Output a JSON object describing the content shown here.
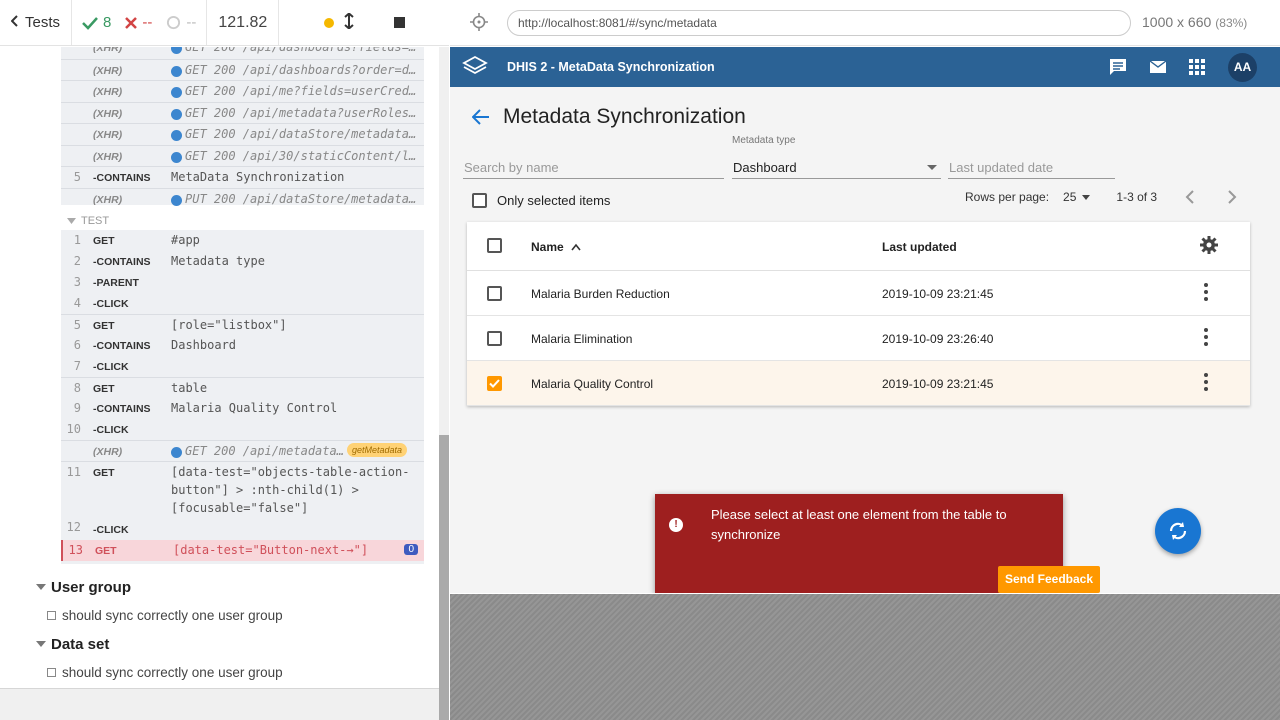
{
  "runner": {
    "tests_label": "Tests",
    "passed": "8",
    "failed": "--",
    "pending": "--",
    "duration": "121.82"
  },
  "reporter": {
    "log_top": [
      {
        "num": "",
        "method": "(XHR)",
        "arg": "GET 200 /api/dashboards?fields=…",
        "type": "xhr"
      },
      {
        "num": "",
        "method": "(XHR)",
        "arg": "GET 200 /api/dashboards?order=display…",
        "type": "xhr"
      },
      {
        "num": "",
        "method": "(XHR)",
        "arg": "GET 200 /api/me?fields=userCred…",
        "type": "xhr"
      },
      {
        "num": "",
        "method": "(XHR)",
        "arg": "GET 200 /api/metadata?userRoles…",
        "type": "xhr"
      },
      {
        "num": "",
        "method": "(XHR)",
        "arg": "GET 200 /api/dataStore/metadata…",
        "type": "xhr"
      },
      {
        "num": "",
        "method": "(XHR)",
        "arg": "GET 200 /api/30/staticContent/l…",
        "type": "xhr"
      },
      {
        "num": "5",
        "method": "-CONTAINS",
        "arg": "MetaData Synchronization",
        "type": "cmd"
      },
      {
        "num": "",
        "method": "(XHR)",
        "arg": "PUT 200 /api/dataStore/metadata…",
        "type": "xhr"
      }
    ],
    "test_header": "TEST",
    "log_test": [
      {
        "num": "1",
        "method": "GET",
        "arg": "#app"
      },
      {
        "num": "2",
        "method": "-CONTAINS",
        "arg": "Metadata type"
      },
      {
        "num": "3",
        "method": "-PARENT",
        "arg": ""
      },
      {
        "num": "4",
        "method": "-CLICK",
        "arg": ""
      },
      {
        "num": "5",
        "method": "GET",
        "arg": "[role=\"listbox\"]"
      },
      {
        "num": "6",
        "method": "-CONTAINS",
        "arg": "Dashboard"
      },
      {
        "num": "7",
        "method": "-CLICK",
        "arg": ""
      },
      {
        "num": "8",
        "method": "GET",
        "arg": "table"
      },
      {
        "num": "9",
        "method": "-CONTAINS",
        "arg": "Malaria Quality Control"
      },
      {
        "num": "10",
        "method": "-CLICK",
        "arg": ""
      }
    ],
    "xhr_meta": {
      "method": "(XHR)",
      "arg": "GET 200 /api/metadata…",
      "alias": "getMetadata"
    },
    "get11": {
      "num": "11",
      "method": "GET",
      "line1": "[data-test=\"objects-table-action-",
      "line2": "button\"] > :nth-child(1) >",
      "line3": "[focusable=\"false\"]"
    },
    "click12": {
      "num": "12",
      "method": "-CLICK"
    },
    "err13": {
      "num": "13",
      "method": "GET",
      "arg": "[data-test=\"Button-next-→\"]",
      "badge": "0"
    },
    "suites": [
      {
        "name": "User group",
        "test": "should sync correctly one user group"
      },
      {
        "name": "Data set",
        "test": "should sync correctly one user group"
      }
    ]
  },
  "aut": {
    "url": "http://localhost:8081/#/sync/metadata",
    "viewport": "1000 x 660",
    "scale": "(83%)"
  },
  "app": {
    "header_title": "DHIS 2 - MetaData Synchronization",
    "avatar": "AA",
    "page_title": "Metadata Synchronization",
    "search_placeholder": "Search by name",
    "metadata_type_label": "Metadata type",
    "metadata_type_value": "Dashboard",
    "last_updated_placeholder": "Last updated date",
    "only_selected": "Only selected items",
    "rows_per_page_label": "Rows per page:",
    "rows_per_page_value": "25",
    "range": "1-3 of 3",
    "col_name": "Name",
    "col_updated": "Last updated",
    "rows": [
      {
        "name": "Malaria Burden Reduction",
        "updated": "2019-10-09 23:21:45",
        "selected": false
      },
      {
        "name": "Malaria Elimination",
        "updated": "2019-10-09 23:26:40",
        "selected": false
      },
      {
        "name": "Malaria Quality Control",
        "updated": "2019-10-09 23:21:45",
        "selected": true
      }
    ],
    "snackbar": "Please select at least one element from the table to synchronize",
    "feedback": "Send Feedback",
    "colors": {
      "header": "#2b6295",
      "snackbar": "#9e1f1f",
      "accent": "#ff9800",
      "fab": "#1976d2"
    }
  }
}
